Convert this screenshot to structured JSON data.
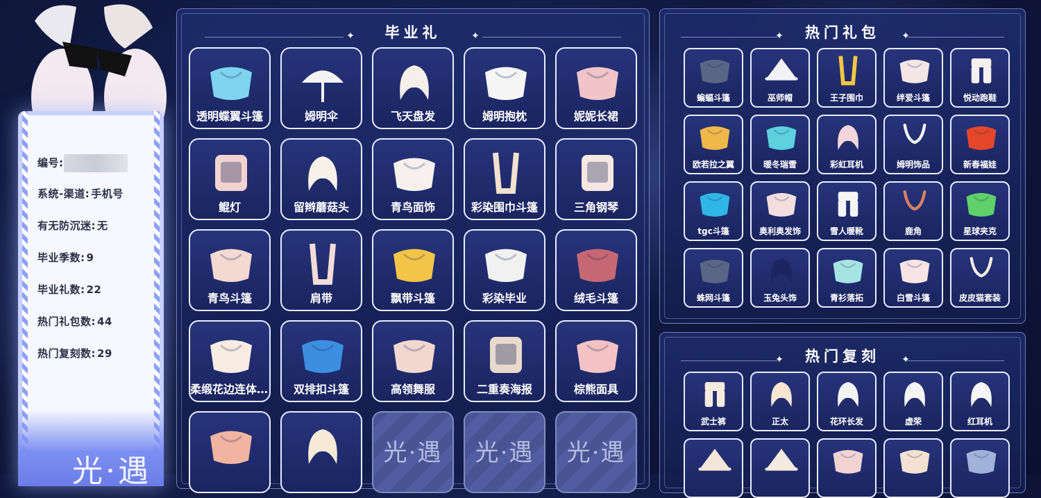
{
  "profile": {
    "rows": [
      {
        "label": "编号:",
        "value": "",
        "blurred": true
      },
      {
        "label": "系统-渠道:",
        "value": "手机号"
      },
      {
        "label": "有无防沉迷:",
        "value": "无"
      },
      {
        "label": "毕业季数:",
        "value": "9"
      },
      {
        "label": "毕业礼数:",
        "value": "22"
      },
      {
        "label": "热门礼包数:",
        "value": "44"
      },
      {
        "label": "热门复刻数:",
        "value": "29"
      }
    ],
    "logo": "光·遇"
  },
  "graduation": {
    "title": "毕业礼",
    "items": [
      {
        "label": "透明蝶翼斗篷",
        "icon": "butterfly-cape-icon",
        "color": "#7fd3ee"
      },
      {
        "label": "姆明伞",
        "icon": "umbrella-icon",
        "color": "#f4f4f4"
      },
      {
        "label": "飞天盘发",
        "icon": "hair-bun-icon",
        "color": "#f6efe9"
      },
      {
        "label": "姆明抱枕",
        "icon": "moomin-pillow-icon",
        "color": "#f5f5f5"
      },
      {
        "label": "妮妮长裙",
        "icon": "dress-icon",
        "color": "#f1c4c9"
      },
      {
        "label": "鲲灯",
        "icon": "lantern-icon",
        "color": "#f2d3d0"
      },
      {
        "label": "留辫蘑菇头",
        "icon": "mushroom-hair-icon",
        "color": "#f7f1e8"
      },
      {
        "label": "青鸟面饰",
        "icon": "bird-mask-icon",
        "color": "#f6f1ec"
      },
      {
        "label": "彩染围巾斗篷",
        "icon": "scarf-cape-icon",
        "color": "#f3e1cf"
      },
      {
        "label": "三角钢琴",
        "icon": "piano-icon",
        "color": "#f5e8e2"
      },
      {
        "label": "青鸟斗篷",
        "icon": "bird-cape-icon",
        "color": "#f4d9d2"
      },
      {
        "label": "肩带",
        "icon": "shoulder-strap-icon",
        "color": "#f3dcd8"
      },
      {
        "label": "飘带斗篷",
        "icon": "ribbon-cape-icon",
        "color": "#f2c549"
      },
      {
        "label": "彩染毕业",
        "icon": "graduation-mask-icon",
        "color": "#f1f1f1"
      },
      {
        "label": "绒毛斗篷",
        "icon": "fluffy-cape-icon",
        "color": "#c56873"
      },
      {
        "label": "柔缎花边连体...",
        "icon": "lace-suit-icon",
        "color": "#f7ebe2"
      },
      {
        "label": "双排扣斗篷",
        "icon": "double-cape-icon",
        "color": "#3c8ee0"
      },
      {
        "label": "高领舞服",
        "icon": "dance-outfit-icon",
        "color": "#f2d6d0"
      },
      {
        "label": "二重奏海报",
        "icon": "poster-icon",
        "color": "#e8d9cc"
      },
      {
        "label": "棕熊面具",
        "icon": "bear-mask-icon",
        "color": "#f2c2c4"
      },
      {
        "label": "",
        "icon": "feather-cape-icon",
        "color": "#f0b4a0"
      },
      {
        "label": "",
        "icon": "fox-hair-icon",
        "color": "#f6ead6"
      },
      {
        "label": "",
        "locked": true
      },
      {
        "label": "",
        "locked": true
      },
      {
        "label": "",
        "locked": true
      }
    ],
    "locked_watermark": "光·遇"
  },
  "hot_packs": {
    "title": "热门礼包",
    "items": [
      {
        "label": "蝙蝠斗篷",
        "icon": "bat-cape-icon",
        "color": "#5a6685"
      },
      {
        "label": "巫师帽",
        "icon": "witch-hat-icon",
        "color": "#f2f2f5"
      },
      {
        "label": "王子围巾",
        "icon": "prince-scarf-icon",
        "color": "#f4c542"
      },
      {
        "label": "绊爱斗篷",
        "icon": "heart-cape-icon",
        "color": "#f5e6e6"
      },
      {
        "label": "悦动跑鞋",
        "icon": "sneaker-icon",
        "color": "#f6f0f0"
      },
      {
        "label": "欧若拉之翼",
        "icon": "aurora-wing-icon",
        "color": "#f0b84a"
      },
      {
        "label": "暖冬瑞雪",
        "icon": "snow-cape-icon",
        "color": "#5ed0e0"
      },
      {
        "label": "彩虹耳机",
        "icon": "rainbow-headphone-icon",
        "color": "#f3d6da"
      },
      {
        "label": "姆明饰品",
        "icon": "moomin-tail-icon",
        "color": "#f5f5f5"
      },
      {
        "label": "新春福娃",
        "icon": "new-year-cape-icon",
        "color": "#e6472b"
      },
      {
        "label": "tgc斗篷",
        "icon": "tgc-cape-icon",
        "color": "#2fb6e6"
      },
      {
        "label": "奥利奥发饰",
        "icon": "dog-ear-icon",
        "color": "#f2dede"
      },
      {
        "label": "雪人暖靴",
        "icon": "snow-boot-icon",
        "color": "#f4f4f4"
      },
      {
        "label": "鹿角",
        "icon": "antler-icon",
        "color": "#d9825e"
      },
      {
        "label": "星球夹克",
        "icon": "planet-jacket-icon",
        "color": "#5fd06a"
      },
      {
        "label": "蛛网斗篷",
        "icon": "web-cape-icon",
        "color": "#5a6685"
      },
      {
        "label": "玉兔头饰",
        "icon": "rabbit-hair-icon",
        "color": "#1d2560"
      },
      {
        "label": "青衫落拓",
        "icon": "green-robe-icon",
        "color": "#a6e4e4"
      },
      {
        "label": "白雪斗篷",
        "icon": "white-cape-icon",
        "color": "#f6e4e4"
      },
      {
        "label": "皮皮猫套装",
        "icon": "cat-tail-icon",
        "color": "#f4ecdf"
      }
    ]
  },
  "hot_reprints": {
    "title": "热门复刻",
    "items": [
      {
        "label": "武士裤",
        "icon": "samurai-pants-icon",
        "color": "#f5ebdf"
      },
      {
        "label": "正太",
        "icon": "boy-hair-icon",
        "color": "#f6e6cf"
      },
      {
        "label": "花环长发",
        "icon": "wreath-hair-icon",
        "color": "#f3f3f3"
      },
      {
        "label": "虚荣",
        "icon": "long-hair-icon",
        "color": "#f4f4f4"
      },
      {
        "label": "红耳机",
        "icon": "headphone-icon",
        "color": "#f5f5f5"
      },
      {
        "label": "",
        "icon": "straw-hat-icon",
        "color": "#f3e6d8"
      },
      {
        "label": "",
        "icon": "bamboo-hat-icon",
        "color": "#f2e9df"
      },
      {
        "label": "",
        "icon": "cape-icon",
        "color": "#f2d3d3"
      },
      {
        "label": "",
        "icon": "robe-icon",
        "color": "#f3e1d1"
      },
      {
        "label": "",
        "icon": "cape-icon",
        "color": "#9fb3d8"
      }
    ]
  }
}
